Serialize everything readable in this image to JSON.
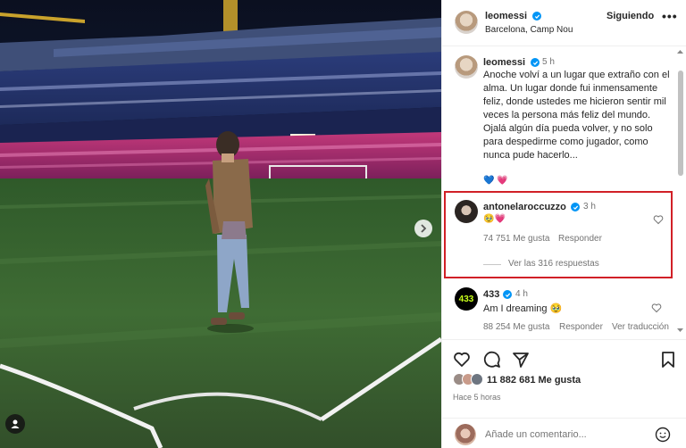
{
  "post": {
    "author": "leomessi",
    "location": "Barcelona, Camp Nou",
    "follow_label": "Siguiendo",
    "more_label": "•••",
    "caption_time": "5 h",
    "caption": "Anoche volví a un lugar que extraño con el alma. Un lugar donde fui inmensamente feliz, donde ustedes me hicieron sentir mil veces la persona más feliz del mundo. Ojalá algún día pueda volver, y no solo para despedirme como jugador, como nunca pude hacerlo...",
    "caption_emojis": "💙 💗"
  },
  "comments": [
    {
      "username": "antonelaroccuzzo",
      "time": "3 h",
      "text": "🥹💗",
      "likes": "74 751 Me gusta",
      "reply_label": "Responder",
      "view_replies": "Ver las 316 respuestas",
      "highlighted": true
    },
    {
      "username": "433",
      "time": "4 h",
      "text": "Am I dreaming 🥹",
      "likes": "88 254 Me gusta",
      "reply_label": "Responder",
      "translate_label": "Ver traducción"
    }
  ],
  "stats": {
    "likes": "11 882 681 Me gusta",
    "posted": "Hace 5 horas"
  },
  "comment_box": {
    "placeholder": "Añade un comentario...",
    "emoji_icon": "smiley-icon"
  },
  "colors": {
    "highlight_border": "#d12027",
    "verified": "#0095f6",
    "brand_433": "#c8ff1a"
  }
}
